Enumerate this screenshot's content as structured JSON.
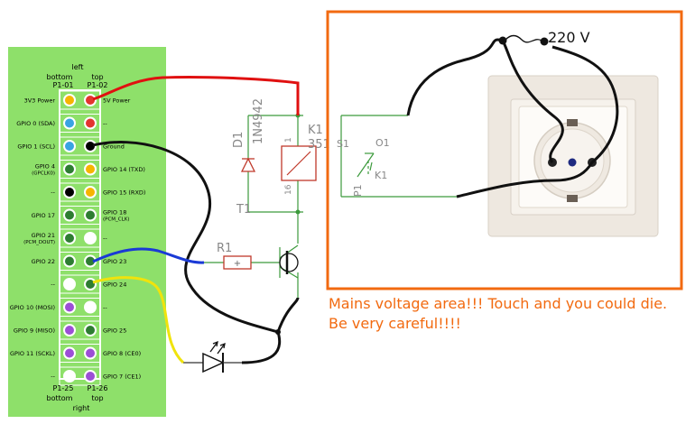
{
  "header": {
    "top_side": "left",
    "bottom_side": "right",
    "col_left_top": "bottom",
    "col_right_top": "top",
    "pin_p1_01": "P1-01",
    "pin_p1_02": "P1-02",
    "pin_p1_25": "P1-25",
    "pin_p1_26": "P1-26"
  },
  "pins": [
    {
      "left": "3V3 Power",
      "left_color": "#f6b400",
      "right": "5V Power",
      "right_color": "#e3342f"
    },
    {
      "left": "GPIO 0 (SDA)",
      "left_color": "#3aa3e3",
      "right": "--",
      "right_color": "#e3342f"
    },
    {
      "left": "GPIO 1 (SCL)",
      "left_color": "#3aa3e3",
      "right": "Ground",
      "right_color": "#000000"
    },
    {
      "left": "GPIO 4",
      "left_sub": "(GPCLK0)",
      "left_color": "#2e7d32",
      "right": "GPIO 14 (TXD)",
      "right_color": "#f6b400"
    },
    {
      "left": "--",
      "left_color": "#000000",
      "right": "GPIO 15 (RXD)",
      "right_color": "#f6b400"
    },
    {
      "left": "GPIO 17",
      "left_color": "#2e7d32",
      "right": "GPIO 18",
      "right_sub": "(PCM_CLK)",
      "right_color": "#2e7d32"
    },
    {
      "left": "GPIO 21",
      "left_sub": "(PCM_DOUT)",
      "left_color": "#2e7d32",
      "right": "--",
      "right_color": "#ffffff"
    },
    {
      "left": "GPIO 22",
      "left_color": "#2e7d32",
      "right": "GPIO 23",
      "right_color": "#2e7d32"
    },
    {
      "left": "--",
      "left_color": "#ffffff",
      "right": "GPIO 24",
      "right_color": "#2e7d32"
    },
    {
      "left": "GPIO 10 (MOSI)",
      "left_color": "#9c4fd6",
      "right": "--",
      "right_color": "#ffffff"
    },
    {
      "left": "GPIO 9 (MISO)",
      "left_color": "#9c4fd6",
      "right": "GPIO 25",
      "right_color": "#2e7d32"
    },
    {
      "left": "GPIO 11 (SCKL)",
      "left_color": "#9c4fd6",
      "right": "GPIO 8 (CE0)",
      "right_color": "#9c4fd6"
    },
    {
      "left": "--",
      "left_color": "#ffffff",
      "right": "GPIO 7 (CE1)",
      "right_color": "#9c4fd6"
    }
  ],
  "circuit": {
    "diode_ref": "D1",
    "diode_part": "1N4942",
    "relay_ref": "K1",
    "relay_part": "351",
    "relay_pin_1": "1",
    "relay_pin_16": "16",
    "transistor_ref": "T1",
    "resistor_ref": "R1",
    "switch_s1": "S1",
    "switch_o1": "O1",
    "switch_k1": "K1",
    "switch_p1": "P1"
  },
  "mains": {
    "voltage_label": "220 V",
    "warning": "Mains voltage area!!! Touch and you could die. Be very careful!!!!"
  },
  "colors": {
    "board_green": "#8ee06a",
    "mains_border": "#f26a10",
    "schematic_green": "#3c9a3c",
    "schematic_red": "#c0392b"
  }
}
